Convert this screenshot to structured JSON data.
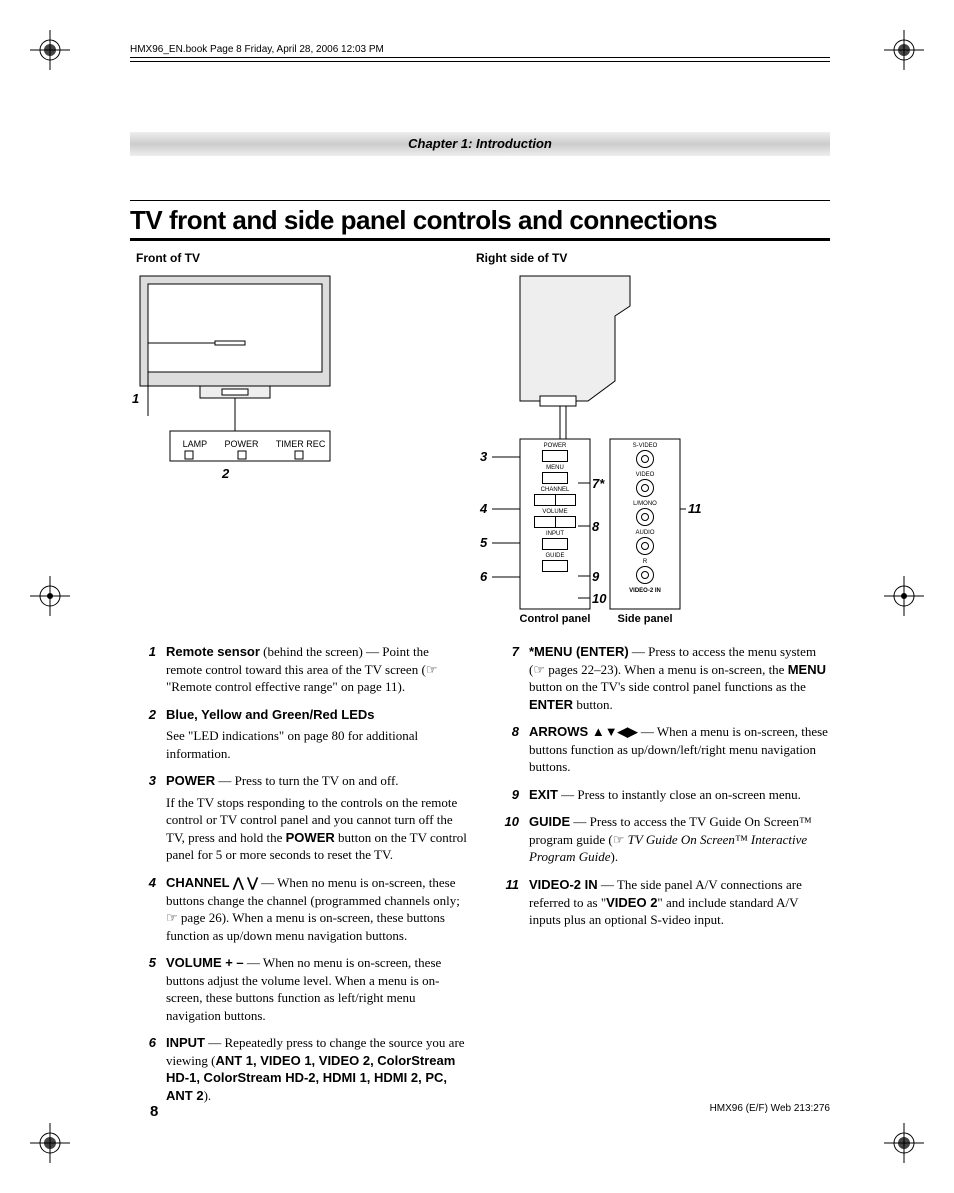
{
  "meta": {
    "book_info": "HMX96_EN.book  Page 8  Friday, April 28, 2006  12:03 PM",
    "chapter": "Chapter 1: Introduction",
    "page_num": "8",
    "footer_right": "HMX96 (E/F) Web 213:276"
  },
  "heading": "TV front and side panel controls and connections",
  "diagram": {
    "front_label": "Front of TV",
    "right_label": "Right side of TV",
    "leds": [
      "LAMP",
      "POWER",
      "TIMER REC"
    ],
    "callouts_left": {
      "c1": "1",
      "c2": "2"
    },
    "panel_buttons": [
      "POWER",
      "MENU",
      "CHANNEL",
      "VOLUME",
      "INPUT",
      "GUIDE"
    ],
    "side_jacks": [
      "S-VIDEO",
      "VIDEO",
      "L/MONO",
      "AUDIO",
      "R"
    ],
    "side_panel_title": "VIDEO-2 IN",
    "callouts_right": {
      "c3": "3",
      "c4": "4",
      "c5": "5",
      "c6": "6",
      "c7": "7*",
      "c8": "8",
      "c9": "9",
      "c10": "10",
      "c11": "11"
    },
    "panel_sub_left": "Control panel",
    "panel_sub_right": "Side panel"
  },
  "items_left": [
    {
      "n": "1",
      "term": "Remote sensor",
      "after": "  (behind the screen) — Point the remote control toward this area of the TV screen (☞ \"Remote control effective range\" on page 11)."
    },
    {
      "n": "2",
      "term": "Blue, Yellow and Green/Red LEDs",
      "sub": "See \"LED indications\" on page 80 for additional information."
    },
    {
      "n": "3",
      "term": "POWER",
      "after": " — Press to turn the TV on and off.",
      "sub": "If the TV stops responding to the controls on the remote control or TV control panel and you cannot turn off the TV, press and hold the ",
      "sub_bold": "POWER",
      "sub_tail": " button on the TV control panel for 5 or more seconds to reset the TV."
    },
    {
      "n": "4",
      "term": "CHANNEL",
      "glyph": " ⋀ ⋁",
      "after": " — When no menu is on-screen, these buttons change the channel (programmed channels only; ☞ page 26). When a menu is on-screen, these buttons function as up/down menu navigation buttons."
    },
    {
      "n": "5",
      "term": "VOLUME + –",
      "after": "  — When no menu is on-screen, these buttons adjust the volume level. When a menu is on-screen, these buttons function as left/right menu navigation buttons."
    },
    {
      "n": "6",
      "term": "INPUT",
      "after": " — Repeatedly press to change the source you are viewing (",
      "inputs": "ANT 1, VIDEO 1, VIDEO 2, ColorStream HD-1, ColorStream HD-2, HDMI 1, HDMI 2, PC, ANT 2",
      "tail": ")."
    }
  ],
  "items_right": [
    {
      "n": "7",
      "term": "*MENU (ENTER)",
      "after": " — Press to access the menu system (☞ pages 22–23). When a menu is on-screen, the ",
      "mid_bold": "MENU",
      "mid_tail": " button on the TV's side control panel functions as the ",
      "end_bold": "ENTER",
      "tail": " button."
    },
    {
      "n": "8",
      "term": "ARROWS",
      "glyph": " ▲▼◀▶",
      "after": " — When a menu is on-screen, these buttons function as up/down/left/right menu navigation buttons."
    },
    {
      "n": "9",
      "term": "EXIT",
      "after": " — Press to instantly close an on-screen menu."
    },
    {
      "n": "10",
      "term": "GUIDE",
      "after": " — Press to access the TV Guide On Screen™ program guide (☞ ",
      "ital": "TV Guide On Screen™ Interactive Program Guide",
      "tail": ")."
    },
    {
      "n": "11",
      "term": "VIDEO-2 IN",
      "after": " — The side panel A/V connections are referred to as \"",
      "mid_bold": "VIDEO 2",
      "tail": "\" and include standard A/V inputs plus an optional S-video input."
    }
  ]
}
